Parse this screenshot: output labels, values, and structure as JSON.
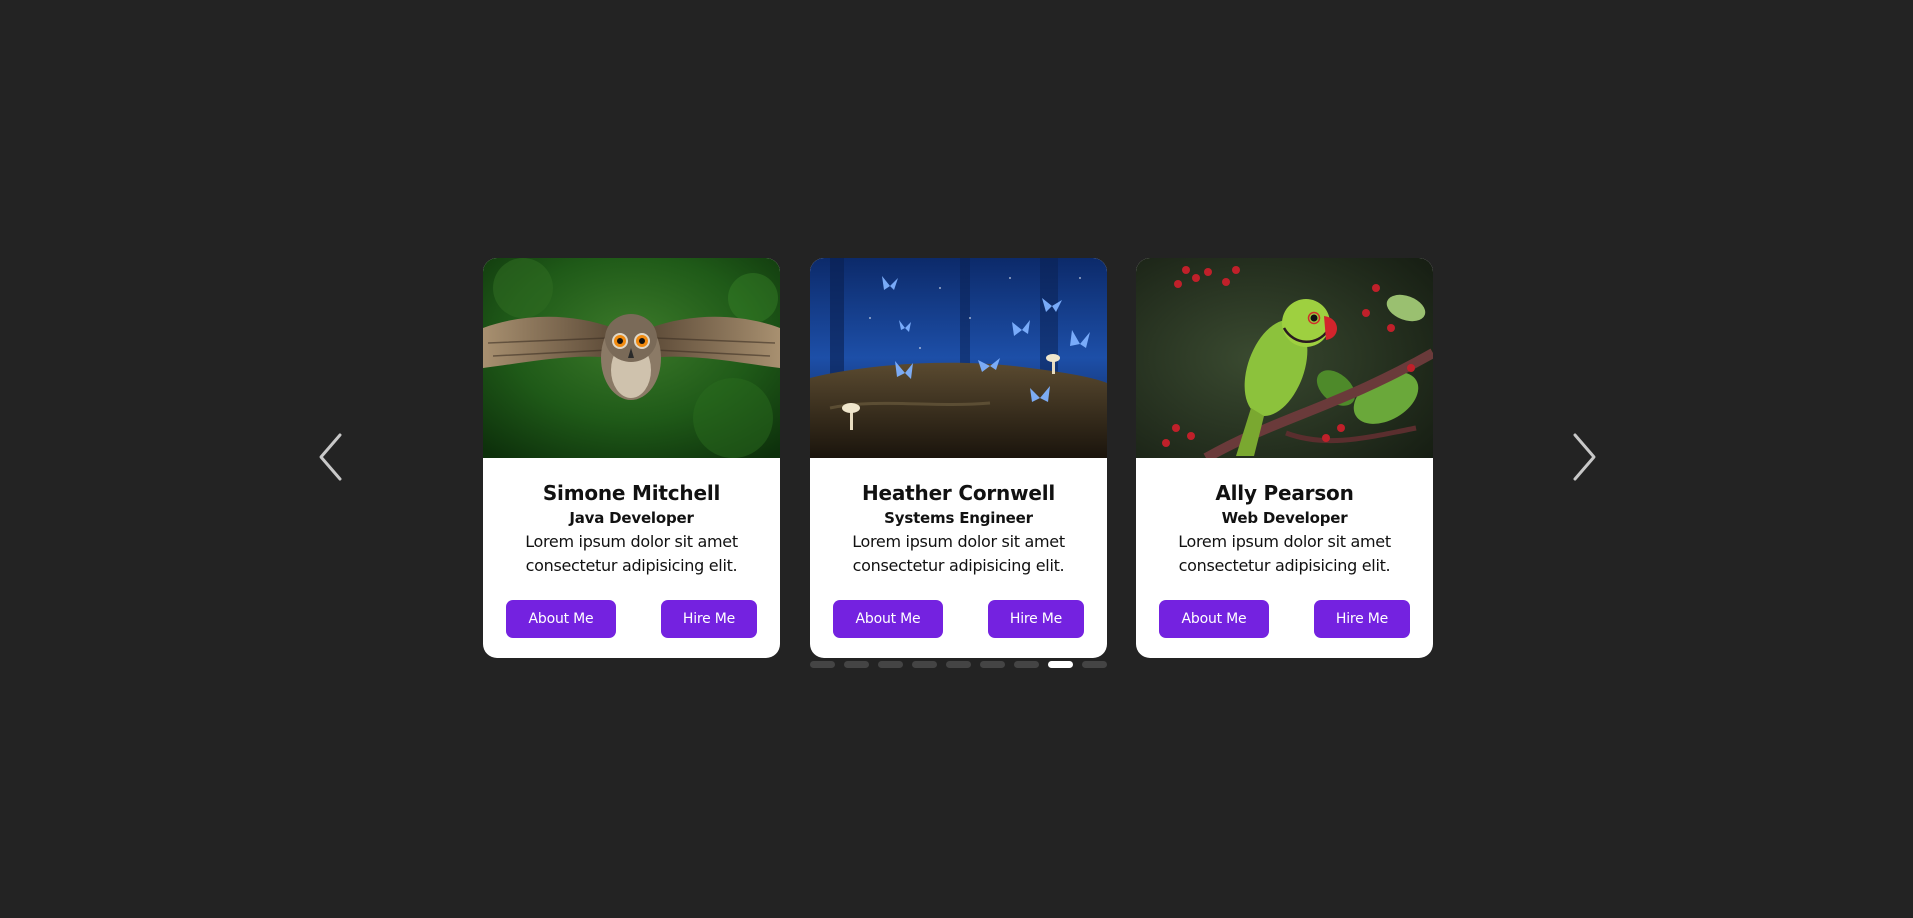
{
  "carousel": {
    "prev_icon": "chevron-left-icon",
    "next_icon": "chevron-right-icon",
    "active_dot": 7,
    "dot_count": 9,
    "colors": {
      "background": "#232323",
      "button": "#7422e0",
      "dot_inactive": "#444444",
      "dot_active": "#ffffff"
    }
  },
  "cards": [
    {
      "name": "Simone Mitchell",
      "role": "Java Developer",
      "desc_line1": "Lorem ipsum dolor sit amet",
      "desc_line2": "consectetur adipisicing elit.",
      "about_label": "About Me",
      "hire_label": "Hire Me",
      "image": "owl-photo"
    },
    {
      "name": "Heather Cornwell",
      "role": "Systems Engineer",
      "desc_line1": "Lorem ipsum dolor sit amet",
      "desc_line2": "consectetur adipisicing elit.",
      "about_label": "About Me",
      "hire_label": "Hire Me",
      "image": "butterflies-photo"
    },
    {
      "name": "Ally Pearson",
      "role": "Web Developer",
      "desc_line1": "Lorem ipsum dolor sit amet",
      "desc_line2": "consectetur adipisicing elit.",
      "about_label": "About Me",
      "hire_label": "Hire Me",
      "image": "parrot-photo"
    }
  ]
}
